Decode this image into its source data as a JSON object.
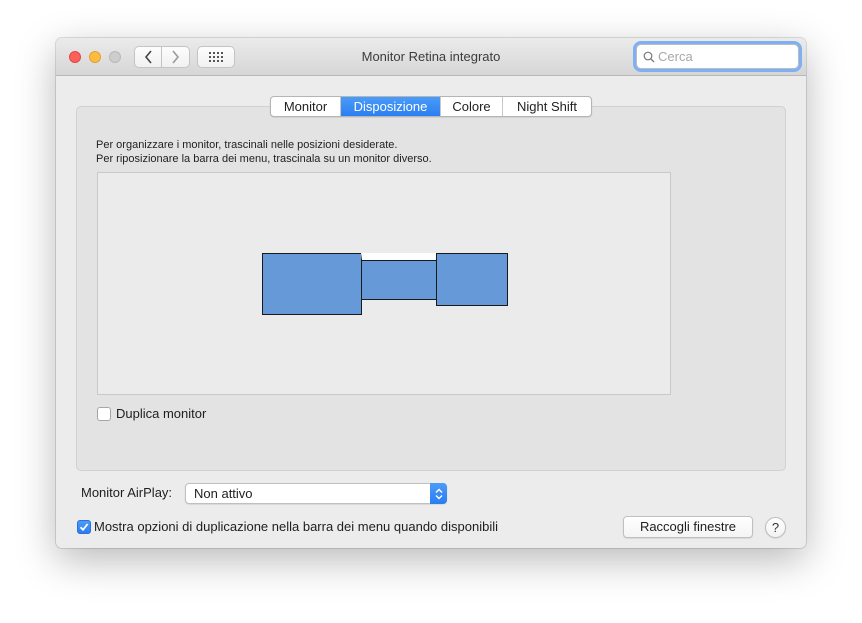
{
  "window": {
    "title": "Monitor Retina integrato"
  },
  "search": {
    "placeholder": "Cerca"
  },
  "tabs": [
    {
      "label": "Monitor",
      "active": false
    },
    {
      "label": "Disposizione",
      "active": true
    },
    {
      "label": "Colore",
      "active": false
    },
    {
      "label": "Night Shift",
      "active": false
    }
  ],
  "arrangement": {
    "instruction_line1": "Per organizzare i monitor, trascinali nelle posizioni desiderate.",
    "instruction_line2": "Per riposizionare la barra dei menu, trascinala su un monitor diverso.",
    "monitor_color": "#6699d7",
    "mirror_displays": {
      "label": "Duplica monitor",
      "checked": false
    }
  },
  "airplay": {
    "label": "Monitor AirPlay:",
    "selected": "Non attivo"
  },
  "menu_bar_option": {
    "label": "Mostra opzioni di duplicazione nella barra dei menu quando disponibili",
    "checked": true
  },
  "buttons": {
    "gather_windows": "Raccogli finestre",
    "help": "?"
  },
  "colors": {
    "accent": "#2b7ef2",
    "close": "#fc605c",
    "minimize": "#fdbc40",
    "zoom_disabled": "#cdcdcd"
  }
}
